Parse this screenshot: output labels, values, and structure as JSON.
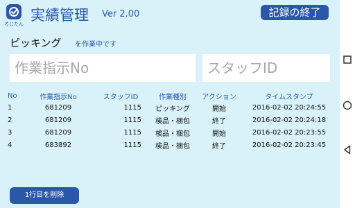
{
  "header": {
    "logo_text": "ろじたん",
    "title": "実績管理",
    "version": "Ver 2.00",
    "end_button": "記録の終了"
  },
  "mode": {
    "label": "ピッキング",
    "suffix": "を作業中です"
  },
  "inputs": {
    "order_placeholder": "作業指示No",
    "order_value": "",
    "staff_placeholder": "スタッフID",
    "staff_value": ""
  },
  "table": {
    "columns": [
      "No",
      "作業指示No",
      "スタッフID",
      "作業種別",
      "アクション",
      "タイムスタンプ"
    ],
    "rows": [
      [
        "1",
        "681209",
        "1115",
        "ピッキング",
        "開始",
        "2016-02-02 20:24:55"
      ],
      [
        "2",
        "681209",
        "1115",
        "検品・梱包",
        "終了",
        "2016-02-02 20:24:18"
      ],
      [
        "3",
        "681209",
        "1115",
        "検品・梱包",
        "開始",
        "2016-02-02 20:23:55"
      ],
      [
        "4",
        "683892",
        "1115",
        "検品・梱包",
        "終了",
        "2016-02-02 20:23:45"
      ]
    ]
  },
  "footer": {
    "delete_button": "1行目を削除"
  },
  "colors": {
    "background": "#d9f2f9",
    "accent": "#2a57a8",
    "input_background": "#ffffff"
  },
  "navbar": {
    "icons": [
      "square-recent-apps-icon",
      "circle-home-icon",
      "triangle-back-icon"
    ]
  }
}
